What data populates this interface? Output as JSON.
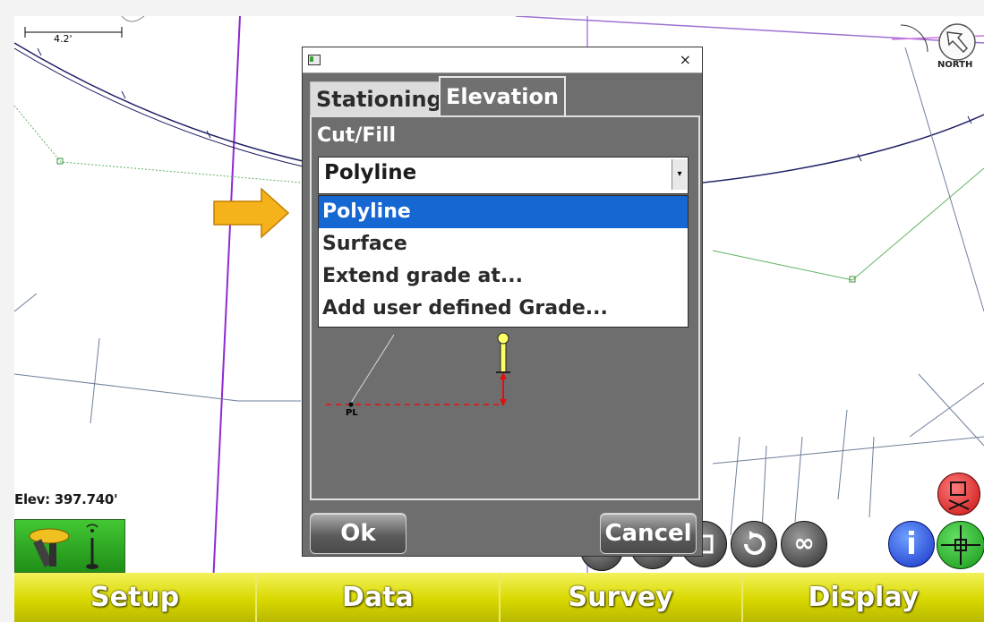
{
  "map": {
    "scale_label": "4.2'",
    "north_label": "NORTH",
    "elevation_readout": "Elev: 397.740'",
    "point_label": "PL"
  },
  "dialog": {
    "tabs": [
      {
        "label": "Stationing",
        "active": false
      },
      {
        "label": "Elevation",
        "active": true
      }
    ],
    "cut_fill_label": "Cut/Fill",
    "combo_value": "Polyline",
    "options": [
      "Polyline",
      "Surface",
      "Extend grade at...",
      "Add user defined Grade..."
    ],
    "selected_option": "Polyline",
    "ok_label": "Ok",
    "cancel_label": "Cancel",
    "close_glyph": "×"
  },
  "bottom_tabs": [
    "Setup",
    "Data",
    "Survey",
    "Display"
  ],
  "icons": {
    "north": "north-arrow-icon",
    "gnss": "gnss-receiver-icon",
    "rover": "rover-pole-icon",
    "help": "info-icon",
    "target": "crosshair-icon",
    "clear": "clear-icon",
    "arrow": "pointer-arrow-icon"
  },
  "colors": {
    "accent_yellow": "#d8d800",
    "selection_blue": "#1567d2",
    "dialog_grey": "#6e6e6e",
    "linework_purple": "#9b1ecf",
    "linework_navy": "#1f2266",
    "linework_green": "#4caf50"
  }
}
